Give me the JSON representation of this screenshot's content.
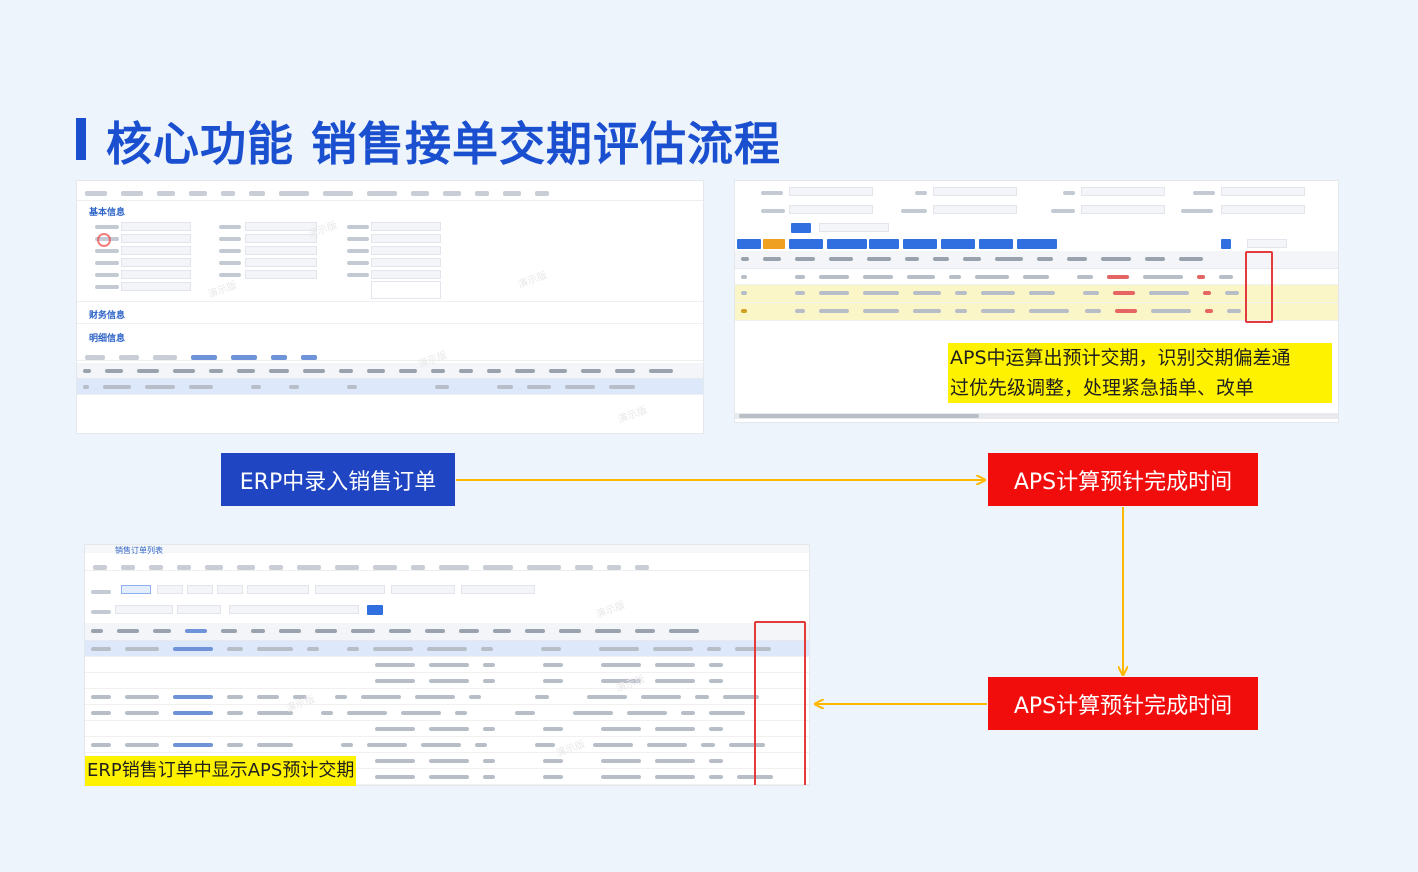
{
  "title": "核心功能  销售接单交期评估流程",
  "steps": {
    "erp_entry": "ERP中录入销售订单",
    "aps_calc_1": "APS计算预针完成时间",
    "aps_calc_2": "APS计算预针完成时间"
  },
  "notes": {
    "aps_note_line1": "APS中运算出预计交期，识别交期偏差通",
    "aps_note_line2": "过优先级调整，处理紧急插单、改单",
    "erp_note": "ERP销售订单中显示APS预计交期"
  },
  "screenshots": {
    "erp_form": {
      "section_basic": "基本信息",
      "section_finance": "财务信息",
      "section_detail": "明细信息"
    },
    "erp_list": {
      "tab": "销售订单列表"
    }
  },
  "colors": {
    "title_blue": "#1a4fd0",
    "box_blue": "#1f45c2",
    "box_red": "#f20d0d",
    "arrow_yellow": "#ffb800",
    "highlight_yellow": "#fff200"
  }
}
